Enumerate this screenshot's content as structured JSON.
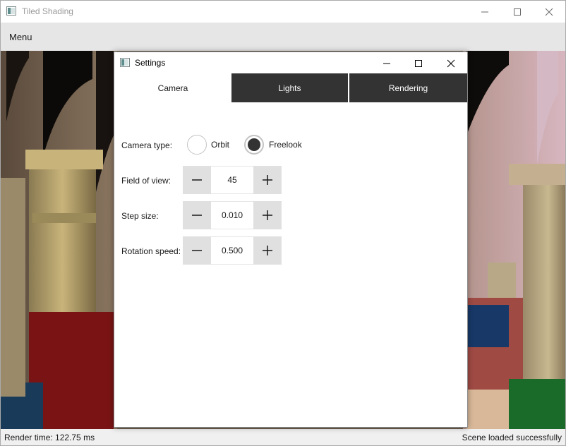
{
  "window": {
    "title": "Tiled Shading",
    "minimize_icon": "minimize-icon",
    "maximize_icon": "maximize-icon",
    "close_icon": "close-icon"
  },
  "menubar": {
    "items": [
      {
        "label": "Menu"
      }
    ]
  },
  "statusbar": {
    "render_time": "Render time: 122.75 ms",
    "message": "Scene loaded successfully"
  },
  "settings": {
    "title": "Settings",
    "tabs": [
      {
        "label": "Camera",
        "active": true
      },
      {
        "label": "Lights",
        "active": false
      },
      {
        "label": "Rendering",
        "active": false
      }
    ],
    "camera": {
      "camera_type_label": "Camera type:",
      "options": [
        {
          "label": "Orbit",
          "selected": false
        },
        {
          "label": "Freelook",
          "selected": true
        }
      ],
      "fields": [
        {
          "label": "Field of view:",
          "value": "45"
        },
        {
          "label": "Step size:",
          "value": "0.010"
        },
        {
          "label": "Rotation speed:",
          "value": "0.500"
        }
      ]
    }
  },
  "colors": {
    "tab_inactive_bg": "#333333",
    "tab_active_bg": "#ffffff",
    "menubar_bg": "#e6e6e6",
    "stepper_button_bg": "#e0e0e0",
    "radio_fill": "#333333"
  }
}
